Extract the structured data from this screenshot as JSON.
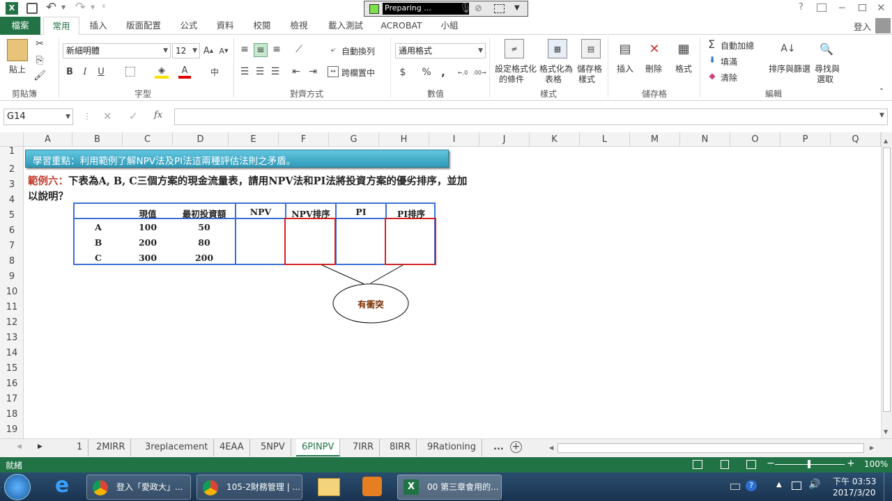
{
  "window": {
    "recording": "Preparing ...",
    "user": "登入"
  },
  "ribbon_tabs": [
    "檔案",
    "常用",
    "插入",
    "版面配置",
    "公式",
    "資料",
    "校閱",
    "檢視",
    "載入測試",
    "ACROBAT",
    "小組"
  ],
  "ribbon": {
    "paste": "貼上",
    "font_name": "新細明體",
    "font_size": "12",
    "wrap_text": "自動換列",
    "merge_center": "跨欄置中",
    "number_format": "通用格式",
    "cond_format": "設定格式化",
    "cond_format2": "的條件",
    "format_table": "格式化為",
    "format_table2": "表格",
    "cell_styles": "儲存格",
    "cell_styles2": "樣式",
    "insert": "插入",
    "delete": "刪除",
    "format": "格式",
    "autosum": "自動加總",
    "fill": "填滿",
    "clear": "清除",
    "sort_filter": "排序與篩選",
    "find_select": "尋找與",
    "find_select2": "選取",
    "groups": {
      "clipboard": "剪貼簿",
      "font": "字型",
      "alignment": "對齊方式",
      "number": "數值",
      "styles": "樣式",
      "cells": "儲存格",
      "editing": "編輯"
    }
  },
  "formula_bar": {
    "name_box": "G14",
    "fx": "fx",
    "content": ""
  },
  "columns": [
    "A",
    "B",
    "C",
    "D",
    "E",
    "F",
    "G",
    "H",
    "I",
    "J",
    "K",
    "L",
    "M",
    "N",
    "O",
    "P",
    "Q"
  ],
  "rows": [
    "1",
    "2",
    "3",
    "4",
    "5",
    "6",
    "7",
    "8",
    "9",
    "10",
    "11",
    "12",
    "13",
    "14",
    "15",
    "16",
    "17",
    "18",
    "19"
  ],
  "sheet": {
    "banner": "學習重點：利用範例了解NPV法及PI法這兩種評估法則之矛盾。",
    "example_label": "範例六：",
    "example_text": "下表為A, B, C三個方案的現金流量表，請用NPV法和PI法將投資方案的優劣排序，並加",
    "example_text2": "以說明？",
    "table": {
      "headers": [
        "",
        "現值",
        "最初投資額",
        "NPV",
        "NPV排序",
        "PI",
        "PI排序"
      ],
      "rows": [
        [
          "A",
          "100",
          "50"
        ],
        [
          "B",
          "200",
          "80"
        ],
        [
          "C",
          "300",
          "200"
        ]
      ]
    },
    "conflict_label": "有衝突"
  },
  "sheet_tabs": [
    "1",
    "2MIRR",
    "3replacement",
    "4EAA",
    "5NPV",
    "6PINPV",
    "7IRR",
    "8IRR",
    "9Rationing",
    "..."
  ],
  "active_sheet": "6PINPV",
  "status": {
    "ready": "就緒",
    "zoom": "100%"
  },
  "taskbar": {
    "items": [
      "登入「愛政大」...",
      "105-2財務管理 | ...",
      "00 第三章會用的..."
    ],
    "time": "下午 03:53",
    "date": "2017/3/20"
  },
  "colors": {
    "excel_green": "#217346",
    "banner": "#3aa6c4",
    "table_blue": "#3a6ed8",
    "table_red": "#d42020",
    "label_red": "#c0392b"
  }
}
